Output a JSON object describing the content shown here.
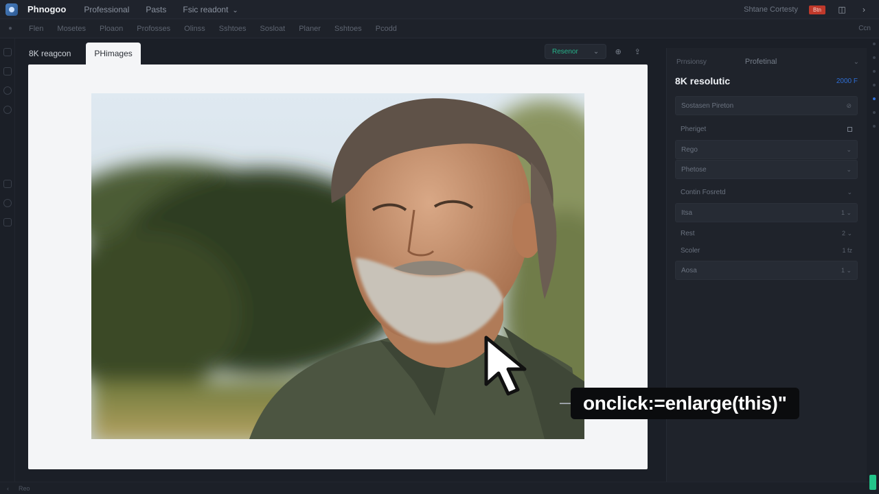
{
  "app": {
    "name": "Phnogoo",
    "top_menu": [
      "Professional",
      "Pasts",
      "Fsic readont"
    ]
  },
  "top_right": {
    "account_label": "Shtane Cortesty",
    "badge_label": "Btn"
  },
  "menubar": {
    "items": [
      "Flen",
      "Mosetes",
      "Ploaon",
      "Profosses",
      "Olinss",
      "Sshtoes",
      "Sosloat",
      "Planer",
      "Sshtoes",
      "Pcodd"
    ],
    "right_label": "Ccn"
  },
  "tabs": [
    {
      "label": "8K reagcon"
    },
    {
      "label": "PHimages"
    }
  ],
  "canvas_toolbar": {
    "primary_label": "Resenor"
  },
  "panel": {
    "header_left": "Prnsionsy",
    "header_center": "Profetinal",
    "title": "8K resolutic",
    "title_value": "2000 F",
    "rows": [
      {
        "label": "Sostasen Pireton",
        "type": "box",
        "right": ""
      },
      {
        "label": "Pheriget",
        "type": "plain",
        "right": ""
      },
      {
        "label": "Rego",
        "type": "box",
        "right": "⌄"
      },
      {
        "label": "Phetose",
        "type": "box",
        "right": "⌄"
      },
      {
        "label": "Contin Fosretd",
        "type": "plain",
        "right": "⌄"
      },
      {
        "label": "Itsa",
        "type": "box",
        "right": "1 ⌄"
      },
      {
        "label": "Rest",
        "type": "plain",
        "right": "2 ⌄"
      },
      {
        "label": "Scoler",
        "type": "plain",
        "right": "1 fz"
      },
      {
        "label": "Aosa",
        "type": "box",
        "right": "1 ⌄"
      }
    ]
  },
  "statusbar": {
    "label": "Reo"
  },
  "overlay": {
    "callout_text": "onclick:=enlarge(this)\""
  },
  "colors": {
    "accent_green": "#26b38a",
    "accent_blue": "#2f6fd6",
    "badge_red": "#c0392b",
    "canvas_bg": "#f4f5f7",
    "app_bg": "#1b1f27"
  }
}
